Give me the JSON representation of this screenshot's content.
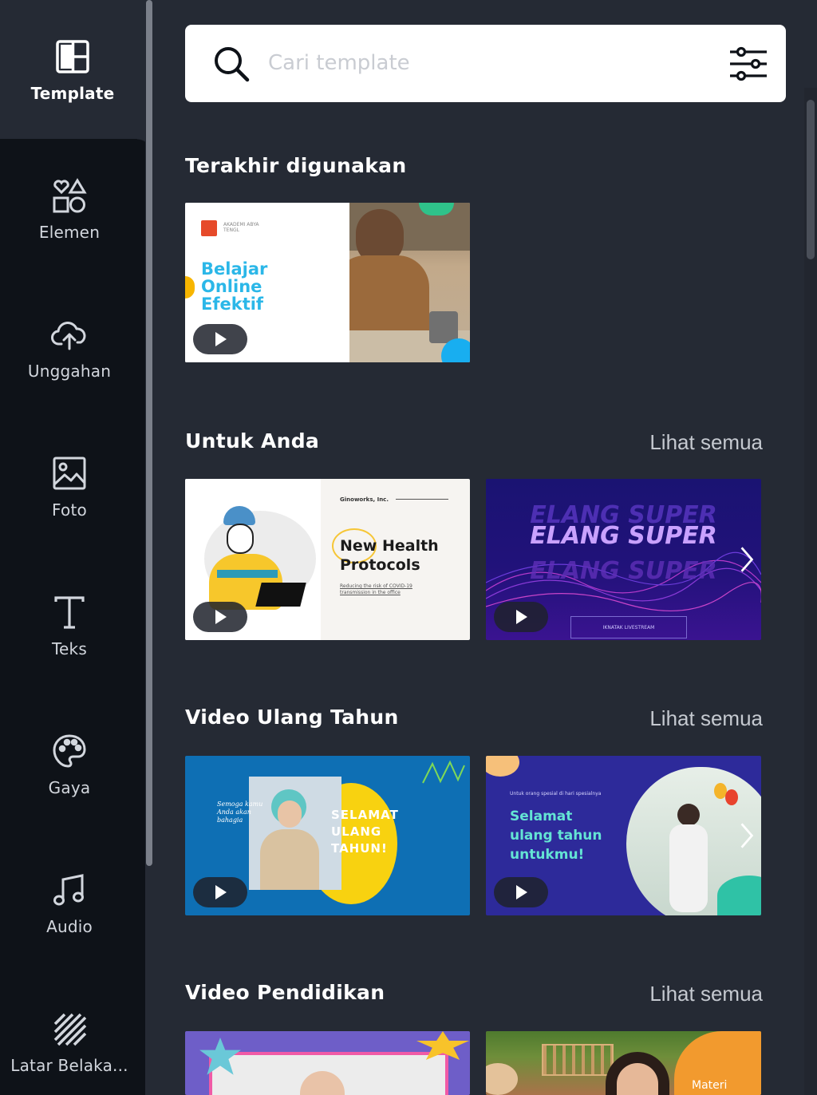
{
  "sidebar": {
    "items": [
      {
        "label": "Template",
        "icon": "template-icon"
      },
      {
        "label": "Elemen",
        "icon": "elements-icon"
      },
      {
        "label": "Unggahan",
        "icon": "upload-cloud-icon"
      },
      {
        "label": "Foto",
        "icon": "photo-icon"
      },
      {
        "label": "Teks",
        "icon": "text-icon"
      },
      {
        "label": "Gaya",
        "icon": "palette-icon"
      },
      {
        "label": "Audio",
        "icon": "music-note-icon"
      },
      {
        "label": "Latar Belaka...",
        "icon": "background-pattern-icon"
      }
    ]
  },
  "search": {
    "placeholder": "Cari template"
  },
  "sections": [
    {
      "title": "Terakhir digunakan"
    },
    {
      "title": "Untuk Anda",
      "see_all": "Lihat semua"
    },
    {
      "title": "Video Ulang Tahun",
      "see_all": "Lihat semua"
    },
    {
      "title": "Video Pendidikan",
      "see_all": "Lihat semua"
    }
  ],
  "thumbs": {
    "recent1": {
      "small": "AKADEMI ABYA TENGL",
      "l1": "Belajar",
      "l2": "Online",
      "l3": "Efektif"
    },
    "foryou1": {
      "company": "Ginoworks, Inc.",
      "l1": "New Health",
      "l2": "Protocols",
      "sub": "Reducing the risk of COVID-19 transmission in the office"
    },
    "foryou2": {
      "l1": "ELANG SUPER",
      "btn": "IKNATAK LIVESTREAM"
    },
    "bday1": {
      "l1": "SELAMAT",
      "l2": "ULANG",
      "l3": "TAHUN!",
      "script": "Semoga kamu Anda akan bahagia"
    },
    "bday2": {
      "small": "Untuk orang spesial di hari spesialnya",
      "l1": "Selamat",
      "l2": "ulang tahun",
      "l3": "untukmu!"
    },
    "edu2": {
      "l1": "Materi"
    }
  },
  "colors": {
    "bg": "#252a34",
    "sidebar": "#0e1218",
    "accent_blue": "#2bb7e8"
  }
}
